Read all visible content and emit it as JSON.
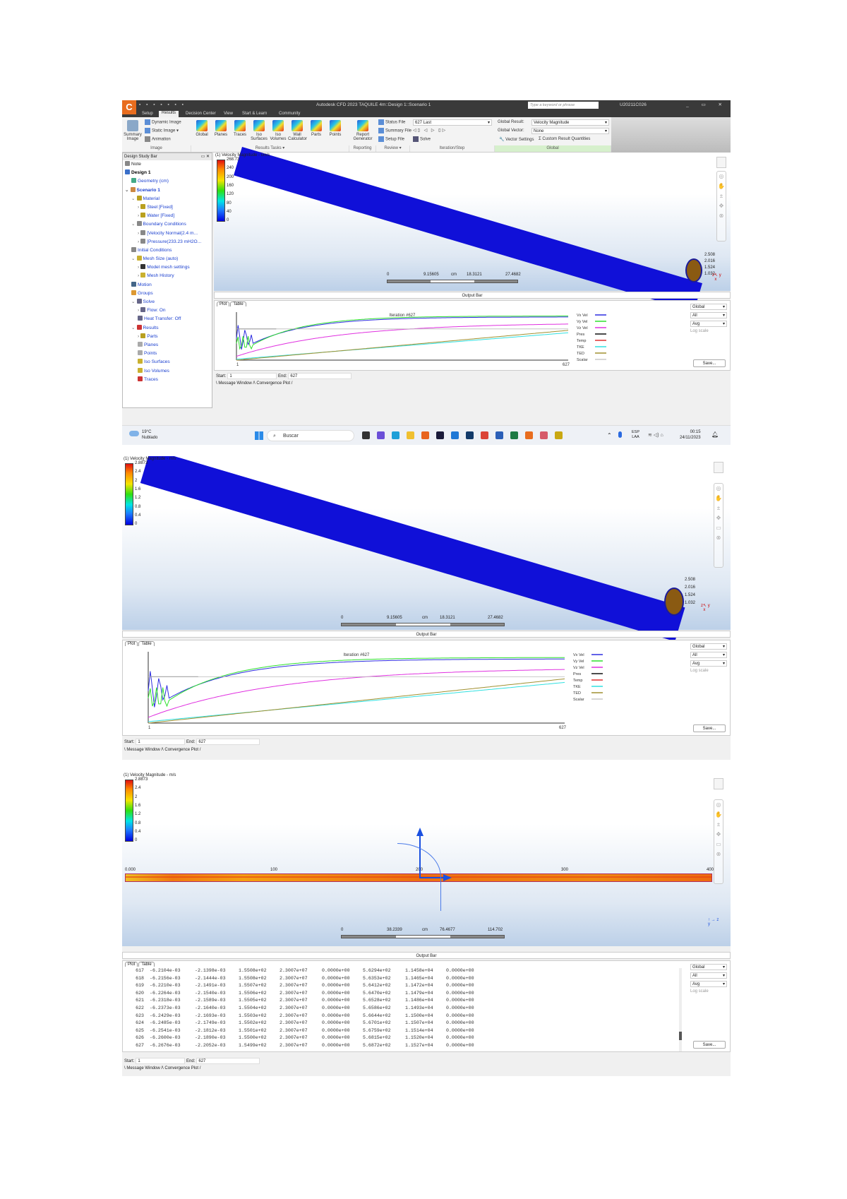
{
  "app": {
    "logo_letter": "C",
    "window_title": "Autodesk CFD 2023   TAQUILE 4m::Design 1::Scenario 1",
    "search_placeholder": "Type a keyword or phrase",
    "username": "U20211C026",
    "window_controls": "_ ▭ ✕",
    "quick_access": "▪ ▪ ▪ ▪ ▪ ▪ ▪"
  },
  "ribbon": {
    "tabs": [
      "Setup",
      "Results",
      "Decision Center",
      "View",
      "Start & Learn",
      "Community"
    ],
    "active_tab": "Results",
    "image_group": {
      "label": "Image",
      "summary_image": "Summary Image",
      "dynamic_image": "Dynamic Image",
      "static_image": "Static Image",
      "animation": "Animation"
    },
    "results_tasks": {
      "label": "Results Tasks ▾",
      "buttons": [
        "Global",
        "Planes",
        "Traces",
        "Iso Surfaces",
        "Iso Volumes",
        "Wall Calculator",
        "Parts",
        "Points"
      ]
    },
    "reporting": {
      "label": "Reporting",
      "report_generator": "Report Generator"
    },
    "review": {
      "label": "Review ▾",
      "status_file": "Status File",
      "summary_file": "Summary File",
      "setup_file": "Setup File"
    },
    "iteration_step": {
      "label": "Iteration/Step",
      "selected": "627 Last",
      "step_controls": "◁▯ ◁ ▷ ▯▷",
      "solve": "Solve"
    },
    "global": {
      "label": "Global",
      "global_result_label": "Global Result:",
      "global_result_value": "Velocity Magnitude",
      "global_vector_label": "Global Vector:",
      "global_vector_value": "None",
      "vector_settings": "Vector Settings",
      "custom_result_quantities": "Custom Result Quantities"
    }
  },
  "design_study_bar": {
    "title": "Design Study Bar",
    "items": [
      {
        "label": "Note",
        "depth": 0,
        "style": "k",
        "icon_color": "#888"
      },
      {
        "label": "Design 1",
        "depth": 0,
        "style": "b",
        "icon_color": "#3a6fc9"
      },
      {
        "label": "Geometry (cm)",
        "depth": 1,
        "style": "",
        "icon_color": "#4a8"
      },
      {
        "label": "Scenario 1",
        "depth": 0,
        "style": "bb",
        "icon_color": "#c84",
        "expander": "v"
      },
      {
        "label": "Material",
        "depth": 1,
        "style": "",
        "icon_color": "#b9a020",
        "expander": "v"
      },
      {
        "label": "Steel [Fixed]",
        "depth": 2,
        "style": "",
        "icon_color": "#b9a020",
        "expander": ">"
      },
      {
        "label": "Water [Fixed]",
        "depth": 2,
        "style": "",
        "icon_color": "#b9a020",
        "expander": ">"
      },
      {
        "label": "Boundary Conditions",
        "depth": 1,
        "style": "",
        "icon_color": "#888",
        "expander": "v"
      },
      {
        "label": "[Velocity Normal(2.4 m...",
        "depth": 2,
        "style": "",
        "icon_color": "#888",
        "expander": ">"
      },
      {
        "label": "[Pressure(233.23 mH2O...",
        "depth": 2,
        "style": "",
        "icon_color": "#888",
        "expander": ">"
      },
      {
        "label": "Initial Conditions",
        "depth": 1,
        "style": "",
        "icon_color": "#888"
      },
      {
        "label": "Mesh Size (auto)",
        "depth": 1,
        "style": "",
        "icon_color": "#c9b030",
        "expander": "v"
      },
      {
        "label": "Model mesh settings",
        "depth": 2,
        "style": "",
        "icon_color": "#333",
        "expander": ">"
      },
      {
        "label": "Mesh History",
        "depth": 2,
        "style": "",
        "icon_color": "#c9b030",
        "expander": ">"
      },
      {
        "label": "Motion",
        "depth": 1,
        "style": "",
        "icon_color": "#468"
      },
      {
        "label": "Groups",
        "depth": 1,
        "style": "",
        "icon_color": "#d93"
      },
      {
        "label": "Solve",
        "depth": 1,
        "style": "",
        "icon_color": "#668",
        "expander": "v"
      },
      {
        "label": "Flow: On",
        "depth": 2,
        "style": "",
        "icon_color": "#668",
        "expander": ">"
      },
      {
        "label": "Heat Transfer: Off",
        "depth": 2,
        "style": "",
        "icon_color": "#668"
      },
      {
        "label": "Results",
        "depth": 1,
        "style": "",
        "icon_color": "#c33",
        "expander": "v"
      },
      {
        "label": "Parts",
        "depth": 2,
        "style": "",
        "icon_color": "#b9a020",
        "expander": ">"
      },
      {
        "label": "Planes",
        "depth": 2,
        "style": "",
        "icon_color": "#aaa"
      },
      {
        "label": "Points",
        "depth": 2,
        "style": "",
        "icon_color": "#aaa"
      },
      {
        "label": "Iso Surfaces",
        "depth": 2,
        "style": "",
        "icon_color": "#c9b030"
      },
      {
        "label": "Iso Volumes",
        "depth": 2,
        "style": "",
        "icon_color": "#c9b030"
      },
      {
        "label": "Traces",
        "depth": 2,
        "style": "",
        "icon_color": "#c33"
      }
    ]
  },
  "legend1": {
    "title": "(1) Velocity Magnitude - cm/s",
    "ticks": [
      "268.73",
      "240",
      "200",
      "160",
      "120",
      "80",
      "40",
      "0"
    ]
  },
  "legend2": {
    "title": "(1) Velocity Magnitude - m/s",
    "ticks": [
      "2.8873",
      "2.4",
      "2",
      "1.6",
      "1.2",
      "0.8",
      "0.4",
      "0"
    ]
  },
  "scale1": {
    "ticks": [
      "0",
      "9.15605",
      "cm",
      "18.3121",
      "27.4682"
    ]
  },
  "scale3": {
    "ticks": [
      "0",
      "38.2339",
      "cm",
      "76.4677",
      "114.702"
    ]
  },
  "pipe_end_labels": [
    "2.508",
    "2.016",
    "1.524",
    "1.032"
  ],
  "ruler3": {
    "ticks": [
      "0.000",
      "100",
      "200",
      "300",
      "400"
    ]
  },
  "triad": {
    "x": "x",
    "y": "y",
    "z": "z"
  },
  "output": {
    "title": "Output Bar",
    "tabs": [
      "Plot",
      "Table"
    ],
    "iteration_label": "Iteration #627",
    "x_start": "1",
    "x_end": "627",
    "dropdowns": [
      "Global",
      "All",
      "Avg"
    ],
    "log_scale": "Log scale",
    "save": "Save...",
    "start_label": "Start:",
    "start_value": "1",
    "end_label": "End:",
    "end_value": "627",
    "bottom_tabs": [
      "Message Window",
      "Convergence Plot"
    ]
  },
  "chart_data": {
    "type": "line",
    "title": "Iteration #627",
    "xlabel": "",
    "ylabel": "",
    "x_range": [
      1,
      627
    ],
    "legend_position": "right",
    "series": [
      {
        "name": "Vx Vel",
        "color": "#2d2de0"
      },
      {
        "name": "Vy Vel",
        "color": "#2ee02e"
      },
      {
        "name": "Vz Vel",
        "color": "#e030e0"
      },
      {
        "name": "Pres",
        "color": "#111111"
      },
      {
        "name": "Temp",
        "color": "#e03030"
      },
      {
        "name": "TKE",
        "color": "#30e0e0"
      },
      {
        "name": "TED",
        "color": "#a09030"
      },
      {
        "name": "Scalar",
        "color": "#c8c8c8"
      }
    ]
  },
  "table": {
    "rows": [
      [
        "617",
        "-6.2104e-03",
        "-2.1398e-03",
        "1.5508e+02",
        "2.3007e+07",
        "0.0000e+00",
        "5.6294e+02",
        "1.1458e+04",
        "0.0000e+00"
      ],
      [
        "618",
        "-6.2156e-03",
        "-2.1444e-03",
        "1.5508e+02",
        "2.3007e+07",
        "0.0000e+00",
        "5.6353e+02",
        "1.1465e+04",
        "0.0000e+00"
      ],
      [
        "619",
        "-6.2210e-03",
        "-2.1491e-03",
        "1.5507e+02",
        "2.3007e+07",
        "0.0000e+00",
        "5.6412e+02",
        "1.1472e+04",
        "0.0000e+00"
      ],
      [
        "620",
        "-6.2264e-03",
        "-2.1540e-03",
        "1.5506e+02",
        "2.3007e+07",
        "0.0000e+00",
        "5.6470e+02",
        "1.1479e+04",
        "0.0000e+00"
      ],
      [
        "621",
        "-6.2318e-03",
        "-2.1589e-03",
        "1.5505e+02",
        "2.3007e+07",
        "0.0000e+00",
        "5.6528e+02",
        "1.1486e+04",
        "0.0000e+00"
      ],
      [
        "622",
        "-6.2373e-03",
        "-2.1640e-03",
        "1.5504e+02",
        "2.3007e+07",
        "0.0000e+00",
        "5.6586e+02",
        "1.1493e+04",
        "0.0000e+00"
      ],
      [
        "623",
        "-6.2429e-03",
        "-2.1693e-03",
        "1.5503e+02",
        "2.3007e+07",
        "0.0000e+00",
        "5.6644e+02",
        "1.1500e+04",
        "0.0000e+00"
      ],
      [
        "624",
        "-6.2485e-03",
        "-2.1749e-03",
        "1.5502e+02",
        "2.3007e+07",
        "0.0000e+00",
        "5.6701e+02",
        "1.1507e+04",
        "0.0000e+00"
      ],
      [
        "625",
        "-6.2541e-03",
        "-2.1812e-03",
        "1.5501e+02",
        "2.3007e+07",
        "0.0000e+00",
        "5.6759e+02",
        "1.1514e+04",
        "0.0000e+00"
      ],
      [
        "626",
        "-6.2600e-03",
        "-2.1890e-03",
        "1.5500e+02",
        "2.3007e+07",
        "0.0000e+00",
        "5.6815e+02",
        "1.1520e+04",
        "0.0000e+00"
      ],
      [
        "627",
        "-6.2676e-03",
        "-2.2052e-03",
        "1.5499e+02",
        "2.3007e+07",
        "0.0000e+00",
        "5.6872e+02",
        "1.1527e+04",
        "0.0000e+00"
      ]
    ]
  },
  "taskbar": {
    "weather_temp": "19°C",
    "weather_desc": "Nublado",
    "search_label": "Buscar",
    "lang_top": "ESP",
    "lang_bottom": "LAA",
    "time": "00:15",
    "date": "24/11/2023",
    "apps": [
      {
        "name": "task-view",
        "color": "#333"
      },
      {
        "name": "chat",
        "color": "#6b4fd8"
      },
      {
        "name": "edge",
        "color": "#1e9fd8"
      },
      {
        "name": "file-explorer",
        "color": "#f0c030"
      },
      {
        "name": "firefox",
        "color": "#e8641e"
      },
      {
        "name": "dropbox",
        "color": "#1a1a3a"
      },
      {
        "name": "mail",
        "color": "#1f78d6"
      },
      {
        "name": "app-store",
        "color": "#123a6a"
      },
      {
        "name": "chrome",
        "color": "#db4437"
      },
      {
        "name": "word",
        "color": "#2b5fb8"
      },
      {
        "name": "excel",
        "color": "#1e7a45"
      },
      {
        "name": "autodesk-cfd",
        "color": "#e86d1f"
      },
      {
        "name": "snipping-tool",
        "color": "#d65a6a"
      },
      {
        "name": "inventor",
        "color": "#c9a812"
      }
    ]
  }
}
